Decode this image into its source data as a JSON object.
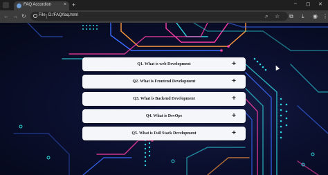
{
  "browser": {
    "tab_title": "FAQ Accordion",
    "tab_close": "×",
    "new_tab": "+",
    "url_scheme": "File",
    "url": "D:/FAQ/faq.html",
    "window_controls": [
      "–",
      "▢",
      "✕"
    ]
  },
  "faq": {
    "items": [
      {
        "question": "Q1. What is web Development",
        "toggle": "+"
      },
      {
        "question": "Q2. What is Frontend Development",
        "toggle": "+"
      },
      {
        "question": "Q3. What is Backend Development",
        "toggle": "+"
      },
      {
        "question": "Q4. What is DevOps",
        "toggle": "+"
      },
      {
        "question": "Q5. What is Full Stack Development",
        "toggle": "+"
      }
    ]
  },
  "colors": {
    "card_bg": "#f5f6fa",
    "page_bg": "#0b1030",
    "circuit_cyan": "#2fd6e0",
    "circuit_pink": "#ff3fa8",
    "circuit_orange": "#ff9a3c",
    "circuit_blue": "#3a6cff"
  },
  "icons": {
    "back": "back-arrow-icon",
    "forward": "forward-arrow-icon",
    "reload": "reload-icon",
    "zoom": "zoom-icon",
    "star": "bookmark-star-icon",
    "extensions": "extensions-icon",
    "download": "download-icon",
    "profile": "profile-icon",
    "menu": "more-menu-icon"
  }
}
